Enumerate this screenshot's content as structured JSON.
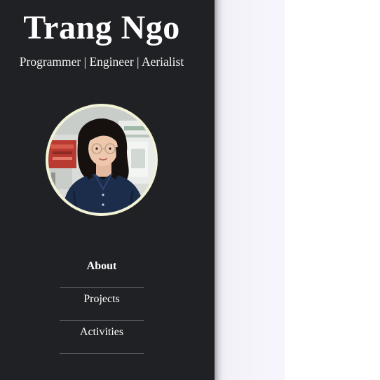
{
  "site": {
    "title": "Trang Ngo",
    "subtitle": "Programmer | Engineer | Aerialist"
  },
  "nav": {
    "items": [
      {
        "label": "About",
        "active": true
      },
      {
        "label": "Projects",
        "active": false
      },
      {
        "label": "Activities",
        "active": false
      }
    ]
  },
  "colors": {
    "sidebar_bg": "#202124",
    "text": "#ffffff",
    "avatar_ring": "#f2f2d6",
    "content_bg": "#f5f3fb"
  }
}
